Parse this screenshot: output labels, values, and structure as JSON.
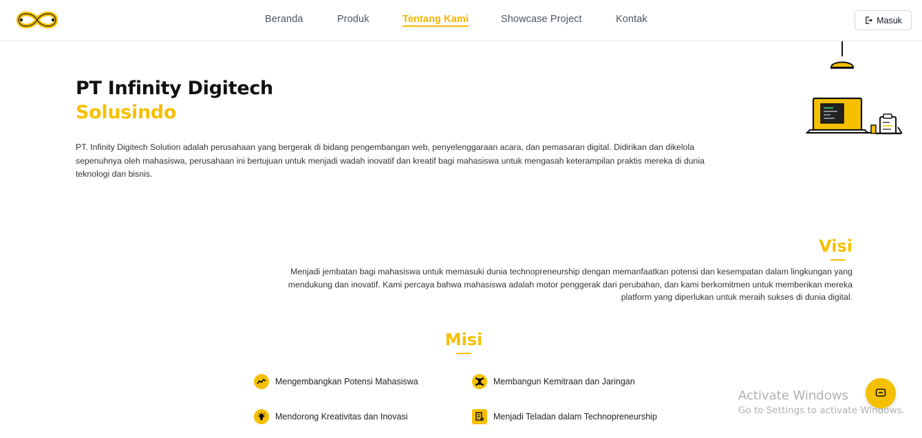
{
  "brand": {
    "logo_icon": "infinity-logo",
    "accent_color": "#f5c000"
  },
  "nav": {
    "items": [
      {
        "label": "Beranda",
        "active": false
      },
      {
        "label": "Produk",
        "active": false
      },
      {
        "label": "Tentang Kami",
        "active": true
      },
      {
        "label": "Showcase Project",
        "active": false
      },
      {
        "label": "Kontak",
        "active": false
      }
    ],
    "login_label": "Masuk",
    "login_icon": "login-icon"
  },
  "hero": {
    "title": "PT Infinity Digitech",
    "subtitle": "Solusindo",
    "description": "PT. Infinity Digitech Solution adalah perusahaan yang bergerak di bidang pengembangan web, penyelenggaraan acara, dan pemasaran digital. Didirikan dan dikelola sepenuhnya oleh mahasiswa, perusahaan ini bertujuan untuk menjadi wadah inovatif dan kreatif bagi mahasiswa untuk mengasah keterampilan praktis mereka di dunia teknologi dan bisnis.",
    "illustration": "laptop-lamp-illustration"
  },
  "visi": {
    "title": "Visi",
    "text": "Menjadi jembatan bagi mahasiswa untuk memasuki dunia technopreneurship dengan memanfaatkan potensi dan kesempatan dalam lingkungan yang mendukung dan inovatif. Kami percaya bahwa mahasiswa adalah motor penggerak dari perubahan, dan kami berkomitmen untuk memberikan mereka platform yang diperlukan untuk meraih sukses di dunia digital."
  },
  "misi": {
    "title": "Misi",
    "items": [
      {
        "label": "Mengembangkan Potensi Mahasiswa",
        "icon": "trend-icon"
      },
      {
        "label": "Membangun Kemitraan dan Jaringan",
        "icon": "network-icon"
      },
      {
        "label": "Mendorong Kreativitas dan Inovasi",
        "icon": "lightbulb-icon"
      },
      {
        "label": "Menjadi Teladan dalam Technopreneurship",
        "icon": "document-gear-icon"
      }
    ]
  },
  "watermark": {
    "title": "Activate Windows",
    "subtitle": "Go to Settings to activate Windows."
  },
  "chat": {
    "icon": "chat-icon"
  }
}
